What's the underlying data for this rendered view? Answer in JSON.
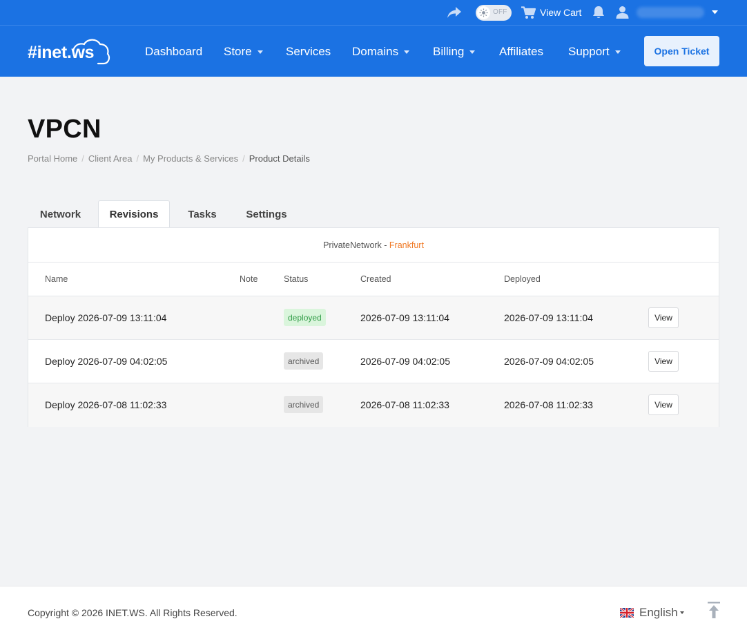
{
  "topbar": {
    "share_icon": "share-arrow-icon",
    "theme_toggle_label": "OFF",
    "view_cart_label": "View Cart",
    "bell_icon": "bell-icon",
    "user_icon": "user-icon"
  },
  "nav": {
    "logo_text": "#inet.ws",
    "items": [
      {
        "label": "Dashboard",
        "dropdown": false
      },
      {
        "label": "Store",
        "dropdown": true
      },
      {
        "label": "Services",
        "dropdown": false
      },
      {
        "label": "Domains",
        "dropdown": true
      },
      {
        "label": "Billing",
        "dropdown": true
      },
      {
        "label": "Affiliates",
        "dropdown": false
      },
      {
        "label": "Support",
        "dropdown": true
      }
    ],
    "open_ticket_label": "Open Ticket"
  },
  "page": {
    "title": "VPCN",
    "breadcrumb": [
      "Portal Home",
      "Client Area",
      "My Products & Services",
      "Product Details"
    ]
  },
  "tabs": [
    {
      "label": "Network",
      "active": false
    },
    {
      "label": "Revisions",
      "active": true
    },
    {
      "label": "Tasks",
      "active": false
    },
    {
      "label": "Settings",
      "active": false
    }
  ],
  "panel": {
    "network_name": "PrivateNetwork",
    "separator": " - ",
    "location": "Frankfurt",
    "columns": [
      "Name",
      "Note",
      "Status",
      "Created",
      "Deployed"
    ],
    "rows": [
      {
        "name": "Deploy 2026-07-09 13:11:04",
        "note": "",
        "status": "deployed",
        "created": "2026-07-09 13:11:04",
        "deployed": "2026-07-09 13:11:04",
        "action": "View"
      },
      {
        "name": "Deploy 2026-07-09 04:02:05",
        "note": "",
        "status": "archived",
        "created": "2026-07-09 04:02:05",
        "deployed": "2026-07-09 04:02:05",
        "action": "View"
      },
      {
        "name": "Deploy 2026-07-08 11:02:33",
        "note": "",
        "status": "archived",
        "created": "2026-07-08 11:02:33",
        "deployed": "2026-07-08 11:02:33",
        "action": "View"
      }
    ]
  },
  "footer": {
    "copyright": "Copyright © 2026 INET.WS. All Rights Reserved.",
    "language": "English",
    "flag_icon": "uk-flag-icon",
    "back_to_top_icon": "back-to-top-icon"
  },
  "colors": {
    "brand_blue": "#1b72e3",
    "page_bg": "#f2f3f5",
    "location_orange": "#f07b28",
    "deployed_green": "#2e9a44"
  }
}
